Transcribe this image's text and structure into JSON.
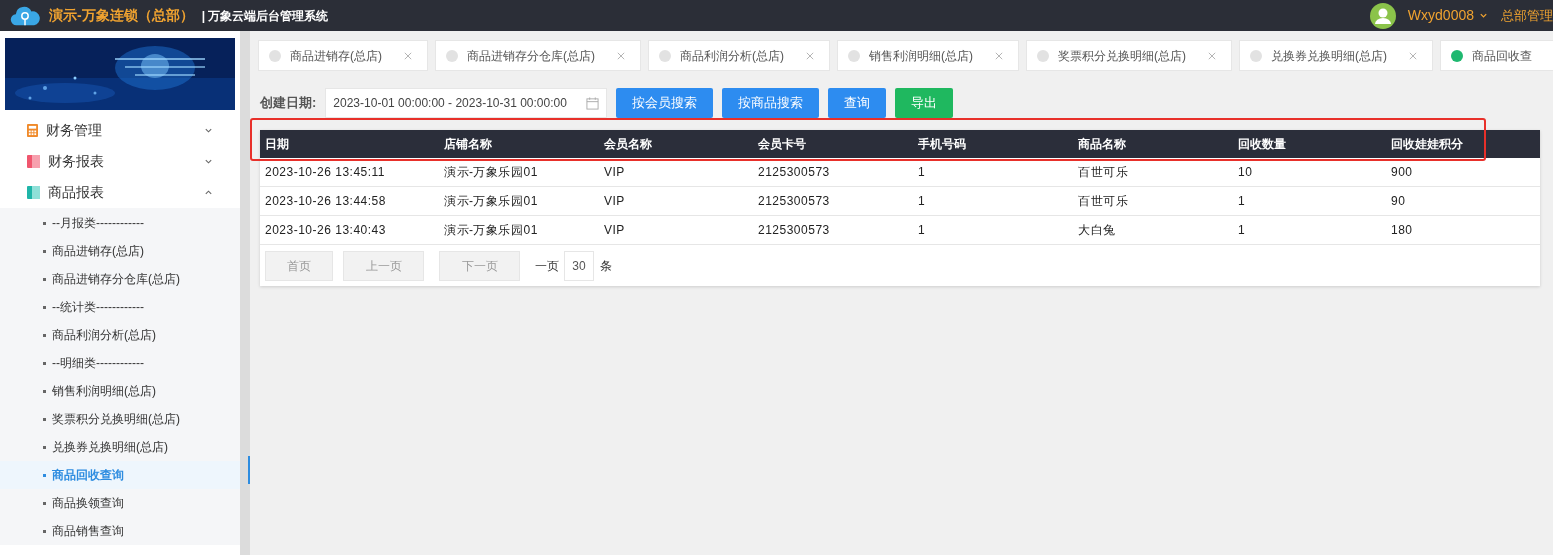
{
  "header": {
    "brand": "演示-万象连锁（总部）",
    "system_title": "| 万象云端后台管理系统",
    "user": "Wxyd0008",
    "role": "总部管理"
  },
  "sidebar": {
    "menus": [
      {
        "label": "财务管理",
        "expanded": false
      },
      {
        "label": "财务报表",
        "expanded": false
      },
      {
        "label": "商品报表",
        "expanded": true,
        "children": [
          {
            "label": "--月报类------------",
            "selected": false
          },
          {
            "label": "商品进销存(总店)",
            "selected": false
          },
          {
            "label": "商品进销存分仓库(总店)",
            "selected": false
          },
          {
            "label": "--统计类------------",
            "selected": false
          },
          {
            "label": "商品利润分析(总店)",
            "selected": false
          },
          {
            "label": "--明细类------------",
            "selected": false
          },
          {
            "label": "销售利润明细(总店)",
            "selected": false
          },
          {
            "label": "奖票积分兑换明细(总店)",
            "selected": false
          },
          {
            "label": "兑换券兑换明细(总店)",
            "selected": false
          },
          {
            "label": "商品回收查询",
            "selected": true
          },
          {
            "label": "商品换领查询",
            "selected": false
          },
          {
            "label": "商品销售查询",
            "selected": false
          }
        ]
      }
    ]
  },
  "tabs": [
    {
      "label": "商品进销存(总店)",
      "selected": false,
      "closable": true
    },
    {
      "label": "商品进销存分仓库(总店)",
      "selected": false,
      "closable": true
    },
    {
      "label": "商品利润分析(总店)",
      "selected": false,
      "closable": true
    },
    {
      "label": "销售利润明细(总店)",
      "selected": false,
      "closable": true
    },
    {
      "label": "奖票积分兑换明细(总店)",
      "selected": false,
      "closable": true
    },
    {
      "label": "兑换券兑换明细(总店)",
      "selected": false,
      "closable": true
    },
    {
      "label": "商品回收查",
      "selected": true,
      "closable": false
    }
  ],
  "filter": {
    "label": "创建日期:",
    "date_range": "2023-10-01 00:00:00 - 2023-10-31 00:00:00",
    "buttons": [
      {
        "label": "按会员搜索",
        "kind": "primary"
      },
      {
        "label": "按商品搜索",
        "kind": "primary"
      },
      {
        "label": "查询",
        "kind": "primary"
      },
      {
        "label": "导出",
        "kind": "success"
      }
    ]
  },
  "table": {
    "highlighted_header": true,
    "columns": [
      "日期",
      "店铺名称",
      "会员名称",
      "会员卡号",
      "手机号码",
      "商品名称",
      "回收数量",
      "回收娃娃积分"
    ],
    "rows": [
      [
        "2023-10-26 13:45:11",
        "演示-万象乐园01",
        "VIP",
        "2125300573",
        "1",
        "百世可乐",
        "10",
        "900"
      ],
      [
        "2023-10-26 13:44:58",
        "演示-万象乐园01",
        "VIP",
        "2125300573",
        "1",
        "百世可乐",
        "1",
        "90"
      ],
      [
        "2023-10-26 13:40:43",
        "演示-万象乐园01",
        "VIP",
        "2125300573",
        "1",
        "大白兔",
        "1",
        "180"
      ]
    ]
  },
  "pagination": {
    "first": "首页",
    "prev": "上一页",
    "next": "下一页",
    "per_page_label": "一页",
    "per_page": "30",
    "unit": "条"
  }
}
